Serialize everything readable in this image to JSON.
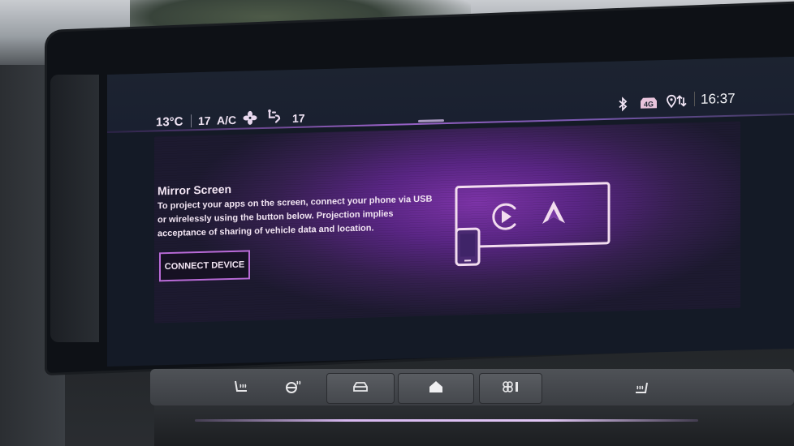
{
  "status_bar": {
    "outside_temp": "13°C",
    "left_temp": "17",
    "ac_label": "A/C",
    "fan_icon": "fan-icon",
    "airflow_icon": "airflow-direction-icon",
    "right_temp": "17",
    "bluetooth_icon": "bluetooth-icon",
    "network_badge": "4G",
    "location_icon": "location-data-icon",
    "time": "16:37"
  },
  "mirror_screen": {
    "title": "Mirror Screen",
    "description": "To project your apps on the screen, connect your phone via USB or wirelessly using the button below. Projection implies acceptance of sharing of vehicle data and location.",
    "connect_button_label": "CONNECT DEVICE",
    "illustration_icons": [
      "phone-icon",
      "apple-carplay-icon",
      "android-auto-icon"
    ]
  },
  "hardware_buttons": [
    {
      "name": "heated-seat-left",
      "icon": "heated-seat-icon"
    },
    {
      "name": "heated-steering",
      "icon": "heated-steering-icon"
    },
    {
      "name": "vehicle",
      "icon": "car-icon"
    },
    {
      "name": "home",
      "icon": "home-icon"
    },
    {
      "name": "climate",
      "icon": "fan-temperature-icon"
    },
    {
      "name": "heated-seat-right",
      "icon": "heated-seat-icon"
    }
  ],
  "colors": {
    "accent": "#b86ad6",
    "panel_glow": "#7d34a8",
    "text": "#f3e6f4"
  }
}
